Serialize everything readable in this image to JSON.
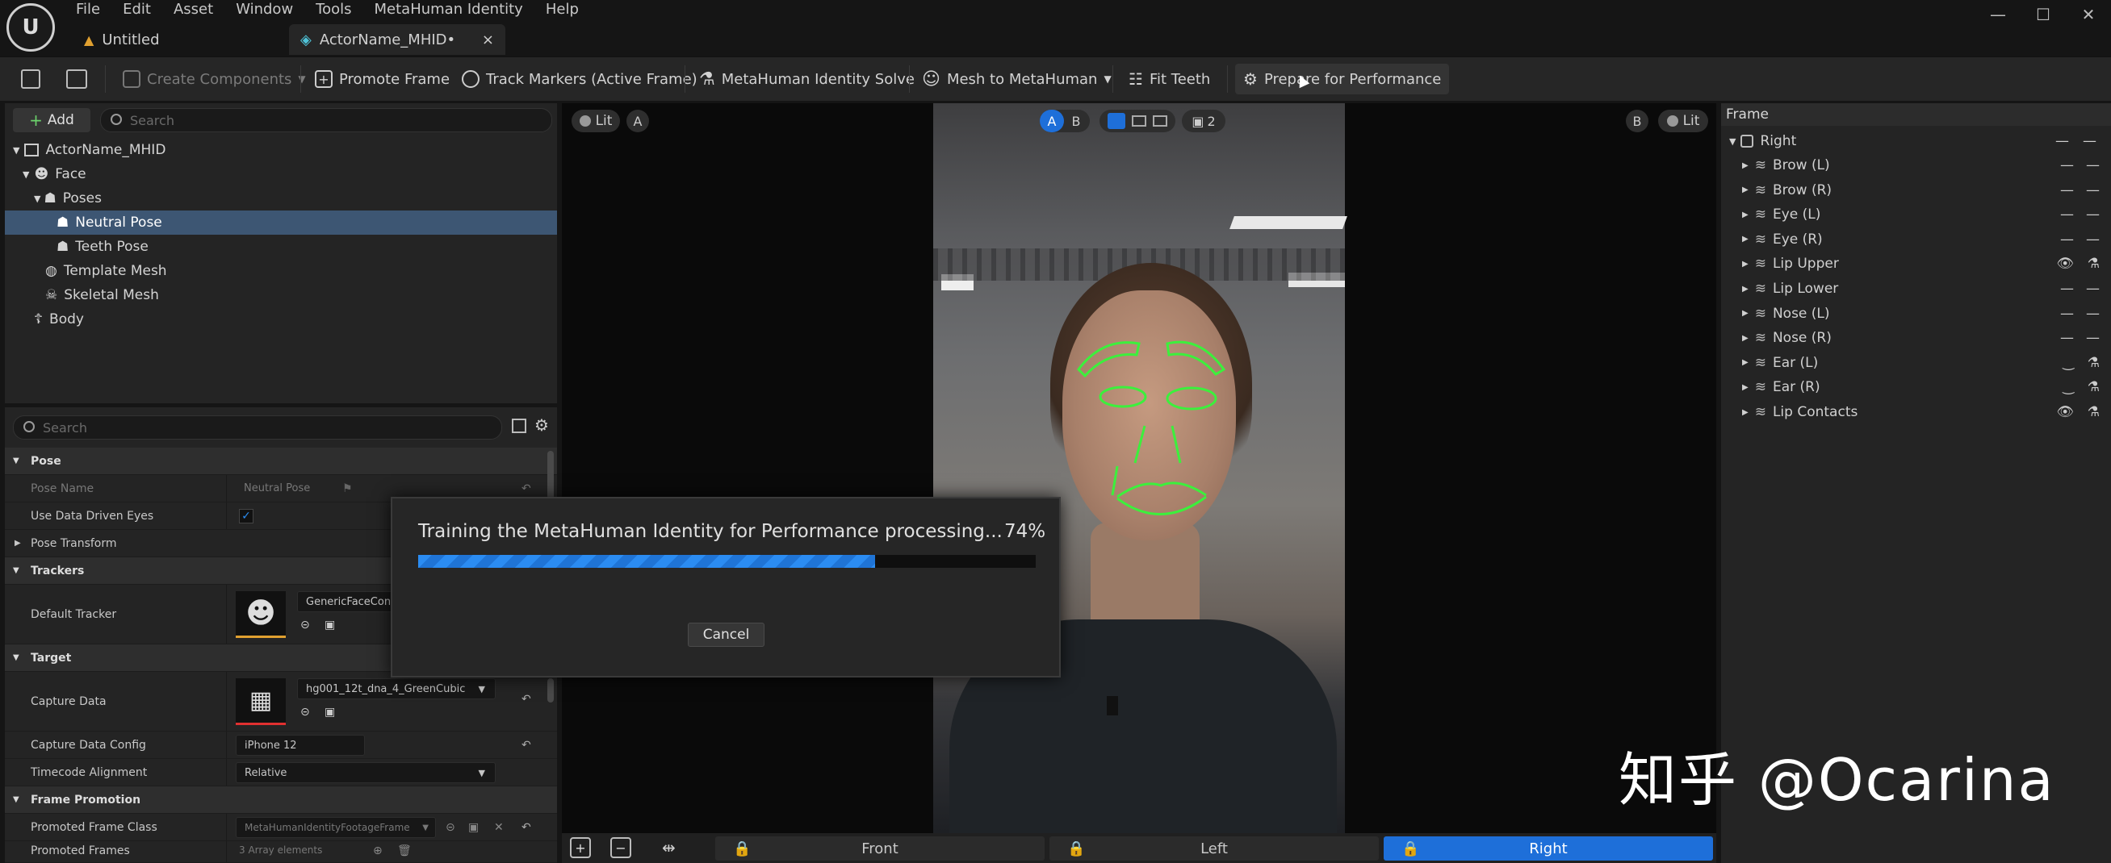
{
  "menu": [
    "File",
    "Edit",
    "Asset",
    "Window",
    "Tools",
    "MetaHuman Identity",
    "Help"
  ],
  "tabs": [
    {
      "label": "Untitled"
    },
    {
      "label": "ActorName_MHID•"
    }
  ],
  "toolbar": {
    "create_components": "Create Components",
    "promote_frame": "Promote Frame",
    "track_markers": "Track Markers (Active Frame)",
    "identity_solve": "MetaHuman Identity Solve",
    "mesh_to_metahuman": "Mesh to MetaHuman",
    "fit_teeth": "Fit Teeth",
    "prepare_performance": "Prepare for Performance"
  },
  "outliner": {
    "add_label": "Add",
    "search_placeholder": "Search",
    "items": [
      {
        "label": "ActorName_MHID"
      },
      {
        "label": "Face"
      },
      {
        "label": "Poses"
      },
      {
        "label": "Neutral Pose"
      },
      {
        "label": "Teeth Pose"
      },
      {
        "label": "Template Mesh"
      },
      {
        "label": "Skeletal Mesh"
      },
      {
        "label": "Body"
      }
    ]
  },
  "details": {
    "search_placeholder": "Search",
    "pose_section": "Pose",
    "pose_name_label": "Pose Name",
    "pose_name_value": "Neutral Pose",
    "use_data_driven_eyes": "Use Data Driven Eyes",
    "pose_transform": "Pose Transform",
    "trackers_section": "Trackers",
    "default_tracker_label": "Default Tracker",
    "default_tracker_value": "GenericFaceConto",
    "target_section": "Target",
    "capture_data_label": "Capture Data",
    "capture_data_value": "hg001_12t_dna_4_GreenCubic",
    "capture_data_config_label": "Capture Data Config",
    "capture_data_config_value": "iPhone 12",
    "timecode_alignment_label": "Timecode Alignment",
    "timecode_alignment_value": "Relative",
    "frame_promotion_section": "Frame Promotion",
    "promoted_frame_class_label": "Promoted Frame Class",
    "promoted_frame_class_value": "MetaHumanIdentityFootageFrame",
    "promoted_frames_label": "Promoted Frames",
    "promoted_frames_value": "3 Array elements"
  },
  "viewport": {
    "lit_left": "Lit",
    "a_label": "A",
    "ab_a": "A",
    "ab_b": "B",
    "split_count": "2",
    "b_label": "B",
    "lit_right": "Lit",
    "bottom_tabs": [
      {
        "label": "Front"
      },
      {
        "label": "Left"
      },
      {
        "label": "Right"
      }
    ]
  },
  "frame_panel": {
    "header": "Frame",
    "root": "Right",
    "items": [
      {
        "label": "Brow (L)"
      },
      {
        "label": "Brow (R)"
      },
      {
        "label": "Eye (L)"
      },
      {
        "label": "Eye (R)"
      },
      {
        "label": "Lip Upper"
      },
      {
        "label": "Lip Lower"
      },
      {
        "label": "Nose (L)"
      },
      {
        "label": "Nose (R)"
      },
      {
        "label": "Ear (L)"
      },
      {
        "label": "Ear (R)"
      },
      {
        "label": "Lip Contacts"
      }
    ]
  },
  "dialog": {
    "message": "Training the MetaHuman Identity for Performance processing...",
    "percent_text": "74%",
    "progress": 0.74,
    "cancel_label": "Cancel"
  },
  "watermark": "知乎 @Ocarina",
  "colors": {
    "accent": "#1e6fd9",
    "selection": "#3d5673",
    "tracking": "#3cf03c"
  }
}
